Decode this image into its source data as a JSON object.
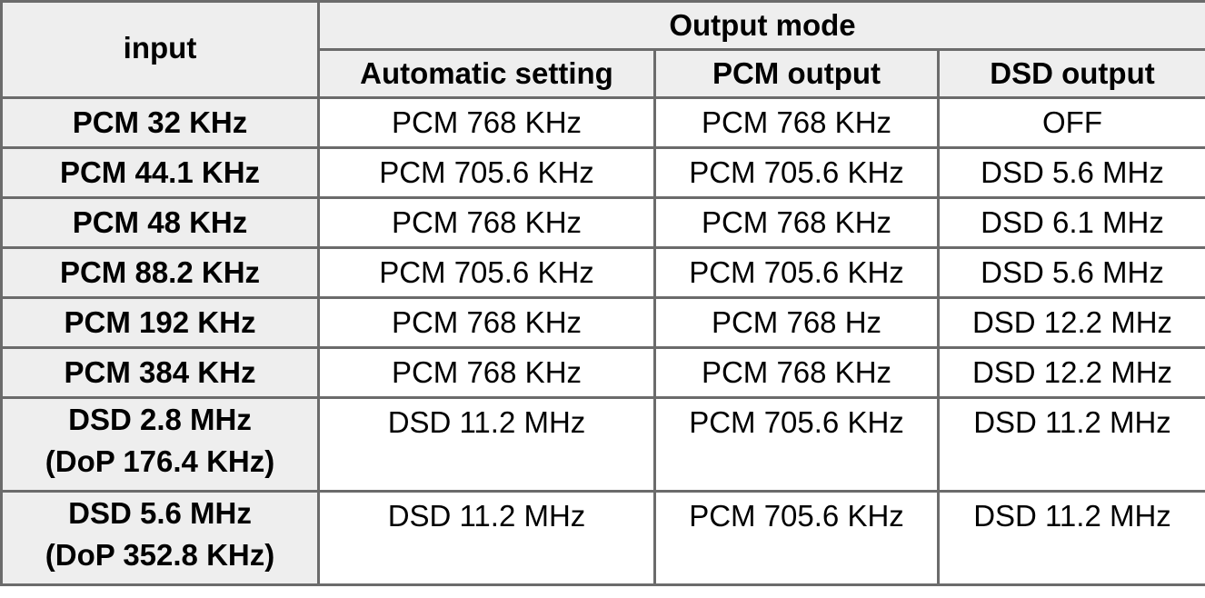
{
  "table": {
    "corner_header": "input",
    "group_header": "Output mode",
    "column_headers": [
      "Automatic setting",
      "PCM output",
      "DSD output"
    ],
    "rows": [
      {
        "input": "PCM 32 KHz",
        "input_sub": "",
        "automatic": "PCM 768 KHz",
        "pcm": "PCM 768 KHz",
        "dsd": "OFF"
      },
      {
        "input": "PCM 44.1 KHz",
        "input_sub": "",
        "automatic": "PCM 705.6 KHz",
        "pcm": "PCM 705.6 KHz",
        "dsd": "DSD 5.6 MHz"
      },
      {
        "input": "PCM 48 KHz",
        "input_sub": "",
        "automatic": "PCM 768 KHz",
        "pcm": "PCM 768 KHz",
        "dsd": "DSD 6.1 MHz"
      },
      {
        "input": "PCM 88.2 KHz",
        "input_sub": "",
        "automatic": "PCM 705.6 KHz",
        "pcm": "PCM 705.6 KHz",
        "dsd": "DSD 5.6 MHz"
      },
      {
        "input": "PCM 192 KHz",
        "input_sub": "",
        "automatic": "PCM 768 KHz",
        "pcm": "PCM 768 Hz",
        "dsd": "DSD 12.2 MHz"
      },
      {
        "input": "PCM 384 KHz",
        "input_sub": "",
        "automatic": "PCM 768 KHz",
        "pcm": "PCM 768 KHz",
        "dsd": "DSD 12.2 MHz"
      },
      {
        "input": "DSD 2.8 MHz",
        "input_sub": "(DoP 176.4 KHz)",
        "automatic": "DSD 11.2 MHz",
        "pcm": "PCM 705.6 KHz",
        "dsd": "DSD 11.2 MHz"
      },
      {
        "input": "DSD 5.6 MHz",
        "input_sub": "(DoP 352.8 KHz)",
        "automatic": "DSD 11.2 MHz",
        "pcm": "PCM 705.6 KHz",
        "dsd": "DSD 11.2 MHz"
      }
    ]
  }
}
